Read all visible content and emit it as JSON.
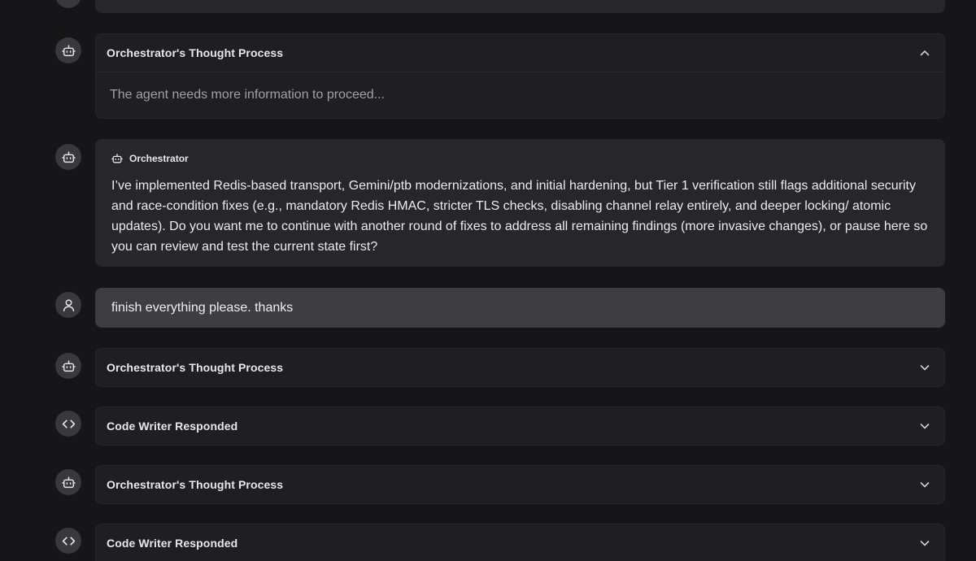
{
  "entries": [
    {
      "type": "thought",
      "title": "Orchestrator's Thought Process",
      "expanded": true,
      "body": "The agent needs more information to proceed...",
      "icon": "robot-icon"
    },
    {
      "type": "message",
      "author": "Orchestrator",
      "text": "I’ve implemented Redis-based transport, Gemini/ptb modernizations, and initial hardening, but Tier 1 verification still flags additional security and race-condition fixes (e.g., mandatory Redis HMAC, stricter TLS checks, disabling channel relay entirely, and deeper locking/ atomic updates). Do you want me to continue with another round of fixes to address all remaining findings (more invasive changes), or pause here so you can review and test the current state first?",
      "icon": "robot-icon"
    },
    {
      "type": "user",
      "text": "finish everything please. thanks",
      "icon": "user-icon"
    },
    {
      "type": "thought",
      "title": "Orchestrator's Thought Process",
      "expanded": false,
      "icon": "robot-icon"
    },
    {
      "type": "code",
      "title": "Code Writer Responded",
      "expanded": false,
      "icon": "code-icon"
    },
    {
      "type": "thought",
      "title": "Orchestrator's Thought Process",
      "expanded": false,
      "icon": "robot-icon"
    },
    {
      "type": "code",
      "title": "Code Writer Responded",
      "expanded": false,
      "icon": "code-icon"
    }
  ],
  "colors": {
    "background": "#161618",
    "card": "#1f1f22",
    "message_card": "#27272b",
    "user_card": "#3d3d42",
    "avatar": "#38383d"
  }
}
